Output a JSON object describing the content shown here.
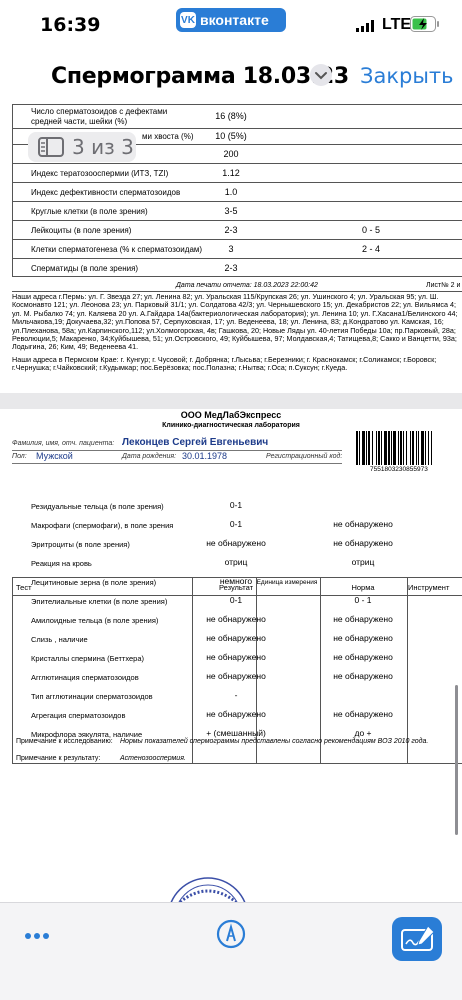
{
  "status_bar": {
    "time": "16:39",
    "app_name": "вконтакте",
    "app_logo": "vk",
    "network": "LTE"
  },
  "nav": {
    "title": "Спермограмма 18.03.23",
    "close": "Закрыть"
  },
  "pager": {
    "label": "3 из 3"
  },
  "sheet1": {
    "rows": [
      {
        "name": "Число сперматозоидов с дефектами средней части, шейки (%)",
        "value": "16 (8%)",
        "norm": ""
      },
      {
        "name": "ми хвоста (%)",
        "value": "10 (5%)",
        "norm": ""
      },
      {
        "name": "",
        "value": "200",
        "norm": ""
      },
      {
        "name": "Индекс тератозооспермии (ИТЗ, TZI)",
        "value": "1.12",
        "norm": ""
      },
      {
        "name": "Индекс дефективности сперматозоидов",
        "value": "1.0",
        "norm": ""
      },
      {
        "name": "Круглые клетки (в поле зрения)",
        "value": "3-5",
        "norm": ""
      },
      {
        "name": "Лейкоциты (в поле зрения)",
        "value": "2-3",
        "norm": "0 - 5"
      },
      {
        "name": "Клетки сперматогенеза (% к сперматозоидам)",
        "value": "3",
        "norm": "2 - 4"
      },
      {
        "name": "Сперматиды (в поле зрения)",
        "value": "2-3",
        "norm": ""
      }
    ],
    "print_date": "Дата печати отчета: 18.03.2023 22:00:42",
    "sheet_num": "Лист№ 2 и",
    "addresses_perm": "Наши адреса г.Пермь: ул. Г. Звезда 27; ул. Ленина 82; ул. Уральская 115/Крупская 26; ул. Ушинского 4; ул. Уральская 95; ул. Ш. Космонавто 121; ул. Леонова 23; ул. Парковый 31/1; ул. Солдатова 42/3; ул. Чернышевского 15; ул. Декабристов 22; ул. Вильямса 4; ул. М. Рыбалко 74; ул. Каляева 20 ул. А.Гайдара 14а(бактериологическая лаборатория); ул. Ленина 10; ул. Г.Хасана1/Белинского 44; Мильчакова,19; Докучаева,32; ул.Попова 57, Серпуховская, 17; ул. Веденеева, 18; ул. Ленина, 83; д.Кондратово ул. Камская, 16; ул.Плеханова, 58а; ул.Карпинского,112; ул.Холмогорская, 4в; Гашкова, 20; Новые Ляды ул. 40-летия Победы 10а; пр.Парковый, 28а; Революции,5; Макаренко, 34;Куйбышева, 51; ул.Островского, 49; Куйбышева, 97; Молдавская,4; Татищева,8; Сакко и Ванцетти, 93а; Лодыгина, 26; Ким, 49; Веденеева 41.",
    "addresses_region": "Наши адреса в Пермском Крае: г. Кунгур; г. Чусовой; г. Добрянка; г.Лысьва; г.Березники; г. Краснокамск; г.Соликамск; г.Боровск; г.Чернушка; г.Чайковский; г.Кудымкар; пос.Берёзовка; пос.Полазна; г.Нытва; г.Оса; п.Суксун; г.Куеда."
  },
  "sheet2": {
    "company": "ООО МедЛабЭкспресс",
    "subtitle": "Клинико-диагностическая лаборатория",
    "patient_label": "Фамилия, имя, отч. пациента:",
    "patient_name": "Леконцев Сергей Евгеньевич",
    "sex_label": "Пол:",
    "sex_value": "Мужской",
    "dob_label": "Дата рождения:",
    "dob_value": "30.01.1978",
    "reg_label": "Регистрационный код:",
    "barcode_number": "7551803230855973",
    "columns": {
      "test": "Тест",
      "result": "Результат",
      "unit": "Единица измерения",
      "norm": "Норма",
      "tool": "Инструмент"
    },
    "rows": [
      {
        "name": "Резидуальные тельца (в поле зрения)",
        "result": "0-1",
        "norm": ""
      },
      {
        "name": "Макрофаги (спермофаги), в поле зрения",
        "result": "0-1",
        "norm": "не обнаружено"
      },
      {
        "name": "Эритроциты (в поле зрения)",
        "result": "не обнаружено",
        "norm": "не обнаружено"
      },
      {
        "name": "Реакция на кровь",
        "result": "отриц",
        "norm": "отриц"
      },
      {
        "name": "Лецитиновые зерна (в поле зрения)",
        "result": "немного",
        "norm": ""
      },
      {
        "name": "Эпителиальные клетки (в поле зрения)",
        "result": "0-1",
        "norm": "0 - 1"
      },
      {
        "name": "Амилоидные тельца (в поле зрения)",
        "result": "не обнаружено",
        "norm": "не обнаружено"
      },
      {
        "name": "Слизь , наличие",
        "result": "не обнаружено",
        "norm": "не обнаружено"
      },
      {
        "name": "Кристаллы спермина (Беттхера)",
        "result": "не обнаружено",
        "norm": "не обнаружено"
      },
      {
        "name": "Агглютинация сперматозоидов",
        "result": "не обнаружено",
        "norm": "не обнаружено"
      },
      {
        "name": "Тип агглютинации сперматозоидов",
        "result": "-",
        "norm": ""
      },
      {
        "name": "Агрегация сперматозоидов",
        "result": "не обнаружено",
        "norm": "не обнаружено"
      },
      {
        "name": "Микрофлора эякулята, наличие",
        "result": "+ (смешанный)",
        "norm": "до +"
      }
    ],
    "note_study_label": "Примечание к исследованию:",
    "note_study_text": "Нормы показателей спермограммы представлены согласно рекомендациям ВОЗ 2010 года.",
    "note_result_label": "Примечание к результату:",
    "note_result_text": "Астенозооспермия."
  },
  "toolbar": {
    "more": "more-icon",
    "markup": "markup-pen-icon",
    "sign": "signature-icon"
  },
  "colors": {
    "accent": "#2a7dd6",
    "vk": "#2a7dd6"
  }
}
